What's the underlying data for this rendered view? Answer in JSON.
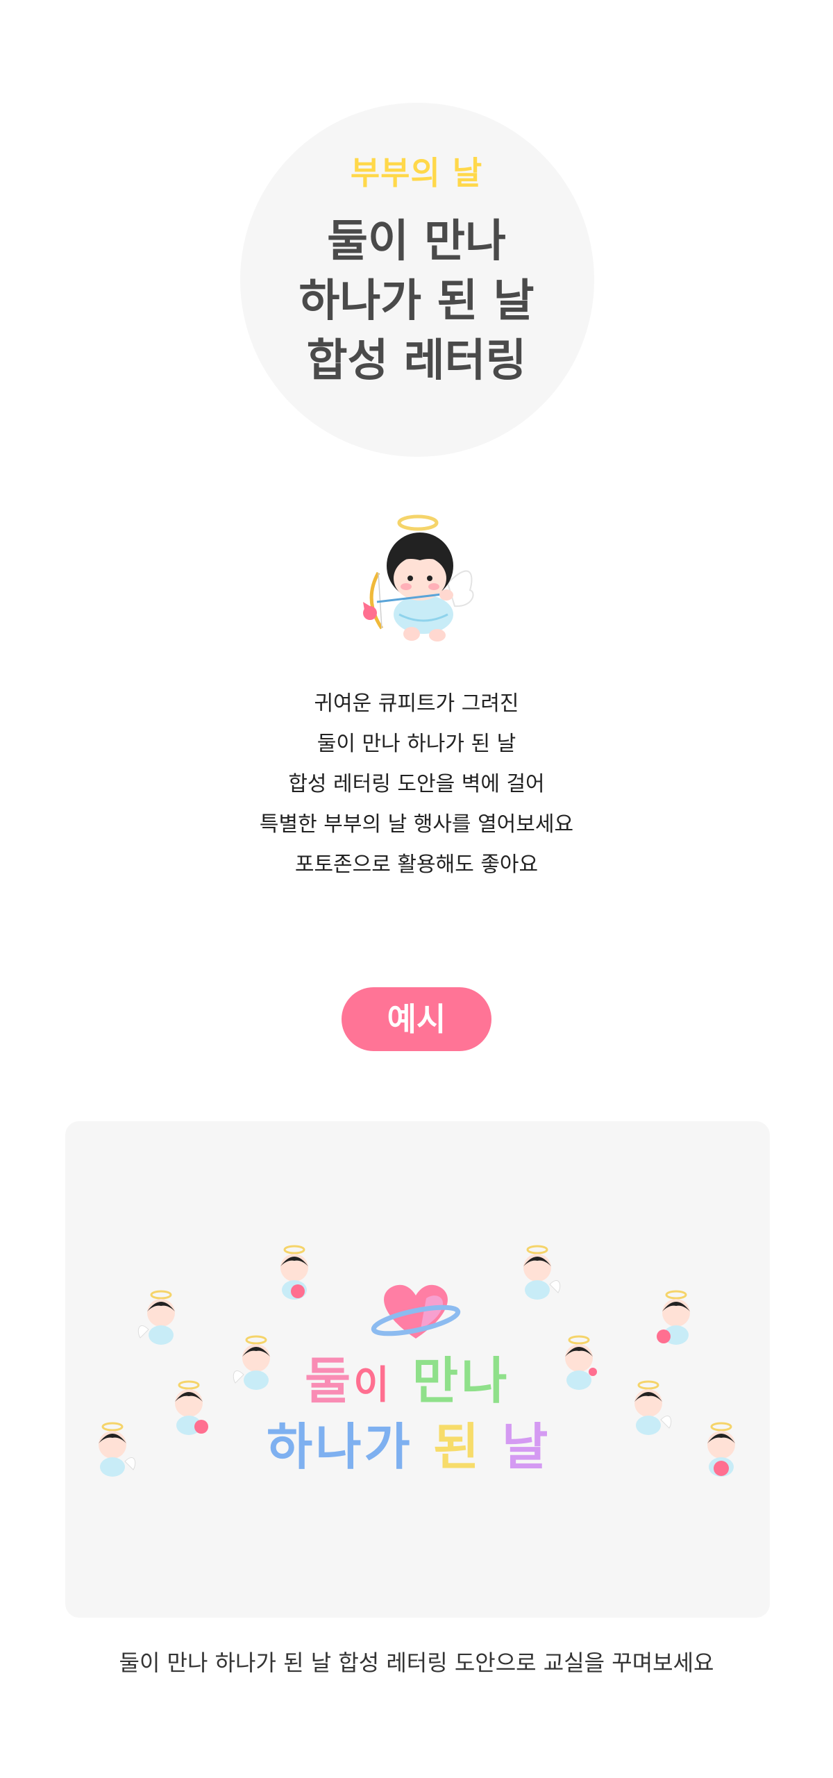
{
  "hero": {
    "subtitle": "부부의 날",
    "title_lines": [
      "둘이 만나",
      "하나가 된 날",
      "합성 레터링"
    ]
  },
  "description": {
    "lines": [
      "귀여운 큐피트가 그려진",
      "둘이 만나 하나가 된 날",
      "합성 레터링 도안을 벽에 걸어",
      "특별한 부부의 날 행사를 열어보세요",
      "포토존으로 활용해도 좋아요"
    ]
  },
  "example": {
    "badge_label": "예시",
    "lettering_line1_parts": [
      "둘",
      "이",
      "만",
      "나"
    ],
    "lettering_line2_parts": [
      "하",
      "나",
      "가",
      "된",
      "날"
    ]
  },
  "caption": "둘이 만나 하나가 된 날 합성 레터링 도안으로 교실을 꾸며보세요",
  "colors": {
    "subtitle_yellow": "#ffd84a",
    "title_gray": "#4a4a4a",
    "badge_pink": "#ff7496",
    "panel_bg": "#f6f6f6",
    "lettering_pink": "#f98cb4",
    "lettering_green": "#8fe08a",
    "lettering_blue": "#7eb0f0",
    "lettering_yellow": "#f7dc6a",
    "lettering_purple": "#d49af2"
  }
}
